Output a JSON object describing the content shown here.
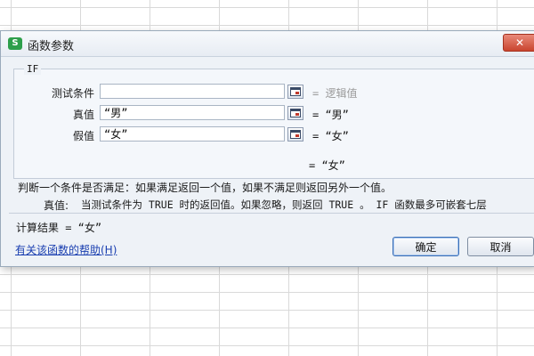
{
  "dialog": {
    "title": "函数参数",
    "app_icon_letter": "S",
    "close_symbol": "✕"
  },
  "function": {
    "name": "IF",
    "args": [
      {
        "label": "测试条件",
        "value": "",
        "result": "= 逻辑值",
        "result_is_placeholder": true
      },
      {
        "label": "真值",
        "value": "“男”",
        "result": "= “男”",
        "result_is_placeholder": false
      },
      {
        "label": "假值",
        "value": "“女”",
        "result": "= “女”",
        "result_is_placeholder": false
      }
    ],
    "overall_result": "= “女”",
    "description": "判断一个条件是否满足：如果满足返回一个值，如果不满足则返回另外一个值。",
    "arg_help_label": "真值:",
    "arg_help_text": "当测试条件为 TRUE 时的返回值。如果忽略，则返回 TRUE 。 IF 函数最多可嵌套七层"
  },
  "calc_result": "计算结果 = “女”",
  "help_link": "有关该函数的帮助(H)",
  "buttons": {
    "ok": "确定",
    "cancel": "取消"
  },
  "icons": {
    "app": "wps-spreadsheet-icon",
    "ref": "collapse-dialog-icon"
  },
  "colors": {
    "app_icon": "#2e9f4b",
    "close_button": "#c9452f",
    "link": "#1a3fb0"
  }
}
